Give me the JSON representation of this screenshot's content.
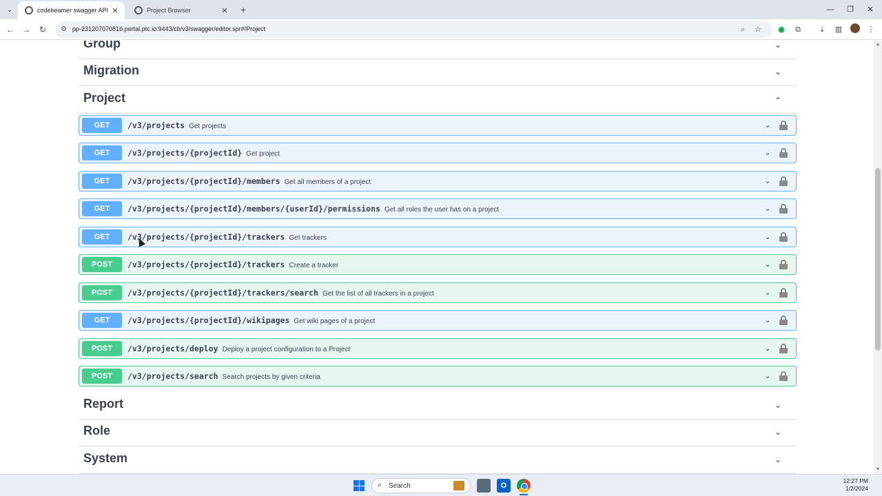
{
  "browser": {
    "tabs": [
      {
        "title": "codebeamer swagger API",
        "active": true
      },
      {
        "title": "Project Browser",
        "active": false
      }
    ],
    "url": "pp-23120707081b.portal.ptc.io:9443/cb/v3/swagger/editor.spr#/Project"
  },
  "sections": {
    "group": "Group",
    "migration": "Migration",
    "project": "Project",
    "report": "Report",
    "role": "Role",
    "system": "System"
  },
  "operations": [
    {
      "method": "GET",
      "path": "/v3/projects",
      "summary": "Get projects"
    },
    {
      "method": "GET",
      "path": "/v3/projects/{projectId}",
      "summary": "Get project"
    },
    {
      "method": "GET",
      "path": "/v3/projects/{projectId}/members",
      "summary": "Get all members of a project"
    },
    {
      "method": "GET",
      "path": "/v3/projects/{projectId}/members/{userId}/permissions",
      "summary": "Get all roles the user has on a project"
    },
    {
      "method": "GET",
      "path": "/v3/projects/{projectId}/trackers",
      "summary": "Get trackers"
    },
    {
      "method": "POST",
      "path": "/v3/projects/{projectId}/trackers",
      "summary": "Create a tracker"
    },
    {
      "method": "POST",
      "path": "/v3/projects/{projectId}/trackers/search",
      "summary": "Get the list of all trackers in a project"
    },
    {
      "method": "GET",
      "path": "/v3/projects/{projectId}/wikipages",
      "summary": "Get wiki pages of a project"
    },
    {
      "method": "POST",
      "path": "/v3/projects/deploy",
      "summary": "Deploy a project configuration to a Project"
    },
    {
      "method": "POST",
      "path": "/v3/projects/search",
      "summary": "Search projects by given criteria"
    }
  ],
  "taskbar": {
    "search_label": "Search",
    "outlook_letter": "O",
    "time": "12:27 PM",
    "date": "1/2/2024"
  },
  "colors": {
    "get": "#61affe",
    "post": "#49cc90"
  }
}
